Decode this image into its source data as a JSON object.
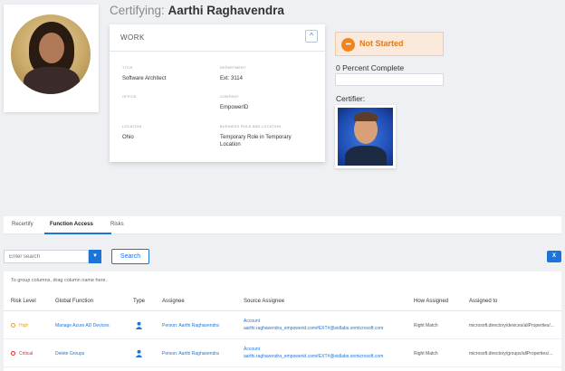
{
  "header": {
    "title_prefix": "Certifying:",
    "person_name": "Aarthi Raghavendra"
  },
  "work": {
    "section_title": "WORK",
    "fields": {
      "title": {
        "label": "TITLE",
        "value": "Software Architect"
      },
      "department": {
        "label": "DEPARTMENT",
        "value": "Ext: 3114"
      },
      "office": {
        "label": "OFFICE",
        "value": ""
      },
      "company": {
        "label": "COMPANY",
        "value": "EmpowerID"
      },
      "location": {
        "label": "LOCATION",
        "value": "Ohio"
      },
      "business_role": {
        "label": "BUSINESS ROLE AND LOCATION",
        "value": "Temporary Role in Temporary Location"
      }
    }
  },
  "status": {
    "label": "Not Started",
    "icon": "ellipsis-icon",
    "percent_text": "0 Percent Complete",
    "percent_value": 0,
    "certifier_label": "Certifier:"
  },
  "tabs": [
    {
      "label": "Recertify",
      "active": false
    },
    {
      "label": "Function Access",
      "active": true
    },
    {
      "label": "Risks",
      "active": false
    }
  ],
  "search": {
    "placeholder": "Enter search",
    "button_label": "Search"
  },
  "grid": {
    "group_hint": "To group columns, drag column name here.",
    "columns": [
      "Risk Level",
      "Global Function",
      "Type",
      "Assignee",
      "Source Assignee",
      "How Assigned",
      "Assigned to"
    ],
    "rows": [
      {
        "risk_level": "High",
        "risk_color": "#e8a317",
        "global_function": "Manage Azure AD Devices",
        "type_icon": "person-icon",
        "assignee": "Person: Aarthi Raghavendra",
        "source_line1": "Account",
        "source_line2": "aarthi.raghavendra_empowerid.com#EXT#@eidlabs.onmicrosoft.com",
        "how_assigned": "Right Match",
        "assigned_to": "microsoft.directory/devices/allProperties/..."
      },
      {
        "risk_level": "Critical",
        "risk_color": "#d93025",
        "global_function": "Delete Groups",
        "type_icon": "person-icon",
        "assignee": "Person: Aarthi Raghavendra",
        "source_line1": "Account",
        "source_line2": "aarthi.raghavendra_empowerid.com#EXT#@eidlabs.onmicrosoft.com",
        "how_assigned": "Right Match",
        "assigned_to": "microsoft.directory/groups/allProperties/..."
      }
    ]
  },
  "colors": {
    "accent": "#1e73d8",
    "status_orange": "#f0831e",
    "status_bg": "#fbe9dc"
  }
}
